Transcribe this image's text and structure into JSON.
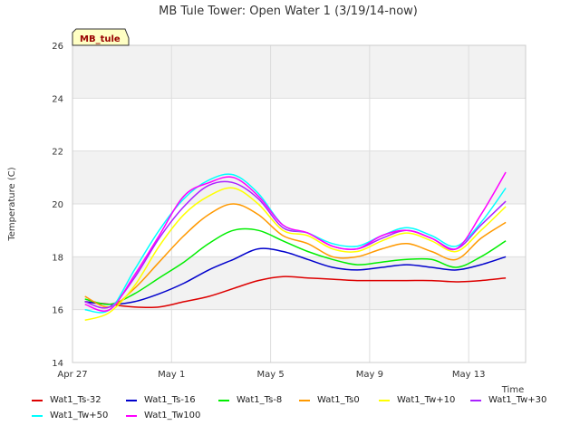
{
  "chart_data": {
    "type": "line",
    "title": "MB Tule Tower: Open Water 1 (3/19/14-now)",
    "xlabel": "Time",
    "ylabel": "Temperature (C)",
    "badge": "MB_tule",
    "xlim": [
      0,
      18.3
    ],
    "ylim": [
      14,
      26
    ],
    "x_ticks": [
      {
        "x": 0,
        "label": "Apr 27"
      },
      {
        "x": 4,
        "label": "May 1"
      },
      {
        "x": 8,
        "label": "May 5"
      },
      {
        "x": 12,
        "label": "May 9"
      },
      {
        "x": 16,
        "label": "May 13"
      }
    ],
    "y_ticks": [
      14,
      16,
      18,
      20,
      22,
      24,
      26
    ],
    "grid": true,
    "legend_position": "bottom",
    "series": [
      {
        "name": "Wat1_Ts-32",
        "color": "#dd0000",
        "x": [
          0.5,
          1.5,
          2.5,
          3.5,
          4.5,
          5.5,
          6.5,
          7.5,
          8.5,
          9.5,
          10.5,
          11.5,
          12.5,
          13.5,
          14.5,
          15.5,
          16.5,
          17.5
        ],
        "y": [
          16.3,
          16.2,
          16.1,
          16.1,
          16.3,
          16.5,
          16.8,
          17.1,
          17.25,
          17.2,
          17.15,
          17.1,
          17.1,
          17.1,
          17.1,
          17.05,
          17.1,
          17.2
        ]
      },
      {
        "name": "Wat1_Ts-16",
        "color": "#0000cc",
        "x": [
          0.5,
          1.5,
          2.5,
          3.5,
          4.5,
          5.5,
          6.5,
          7.5,
          8.5,
          9.5,
          10.5,
          11.5,
          12.5,
          13.5,
          14.5,
          15.5,
          16.5,
          17.5
        ],
        "y": [
          16.3,
          16.2,
          16.3,
          16.6,
          17.0,
          17.5,
          17.9,
          18.3,
          18.2,
          17.9,
          17.6,
          17.5,
          17.6,
          17.7,
          17.6,
          17.5,
          17.7,
          18.0
        ]
      },
      {
        "name": "Wat1_Ts-8",
        "color": "#00ee00",
        "x": [
          0.5,
          1.5,
          2.5,
          3.5,
          4.5,
          5.5,
          6.5,
          7.5,
          8.5,
          9.5,
          10.5,
          11.5,
          12.5,
          13.5,
          14.5,
          15.5,
          16.5,
          17.5
        ],
        "y": [
          16.4,
          16.2,
          16.6,
          17.2,
          17.8,
          18.5,
          19.0,
          19.0,
          18.6,
          18.2,
          17.9,
          17.7,
          17.8,
          17.9,
          17.9,
          17.6,
          18.0,
          18.6
        ]
      },
      {
        "name": "Wat1_Ts0",
        "color": "#ff9900",
        "x": [
          0.5,
          1.5,
          2.5,
          3.5,
          4.5,
          5.5,
          6.5,
          7.5,
          8.5,
          9.5,
          10.5,
          11.5,
          12.5,
          13.5,
          14.5,
          15.5,
          16.5,
          17.5
        ],
        "y": [
          16.5,
          16.1,
          16.8,
          17.8,
          18.8,
          19.6,
          20.0,
          19.6,
          18.8,
          18.5,
          18.0,
          18.0,
          18.3,
          18.5,
          18.2,
          17.9,
          18.7,
          19.3
        ]
      },
      {
        "name": "Wat1_Tw+10",
        "color": "#ffff00",
        "x": [
          0.5,
          1.5,
          2.5,
          3.5,
          4.5,
          5.5,
          6.5,
          7.5,
          8.5,
          9.5,
          10.5,
          11.5,
          12.5,
          13.5,
          14.5,
          15.5,
          16.5,
          17.5
        ],
        "y": [
          15.6,
          15.9,
          16.9,
          18.4,
          19.6,
          20.3,
          20.6,
          20.0,
          19.0,
          18.8,
          18.3,
          18.2,
          18.6,
          18.9,
          18.6,
          18.2,
          19.0,
          19.9
        ]
      },
      {
        "name": "Wat1_Tw+30",
        "color": "#aa22ff",
        "x": [
          0.5,
          1.5,
          2.5,
          3.5,
          4.5,
          5.5,
          6.5,
          7.5,
          8.5,
          9.5,
          10.5,
          11.5,
          12.5,
          13.5,
          14.5,
          15.5,
          16.5,
          17.5
        ],
        "y": [
          16.3,
          16.1,
          17.2,
          18.7,
          19.9,
          20.7,
          20.8,
          20.2,
          19.1,
          18.9,
          18.4,
          18.3,
          18.7,
          19.0,
          18.7,
          18.3,
          19.2,
          20.1
        ]
      },
      {
        "name": "Wat1_Tw+50",
        "color": "#00ffff",
        "x": [
          0.5,
          1.5,
          2.5,
          3.5,
          4.5,
          5.5,
          6.5,
          7.5,
          8.5,
          9.5,
          10.5,
          11.5,
          12.5,
          13.5,
          14.5,
          15.5,
          16.5,
          17.5
        ],
        "y": [
          16.0,
          16.0,
          17.5,
          19.0,
          20.2,
          20.9,
          21.1,
          20.4,
          19.2,
          18.9,
          18.5,
          18.4,
          18.8,
          19.1,
          18.8,
          18.4,
          19.3,
          20.6
        ]
      },
      {
        "name": "Wat1_Tw100",
        "color": "#ff00ff",
        "x": [
          0.5,
          1.5,
          2.5,
          3.5,
          4.5,
          5.5,
          6.5,
          7.5,
          8.5,
          9.5,
          10.5,
          11.5,
          12.5,
          13.5,
          14.5,
          15.5,
          16.5,
          17.5
        ],
        "y": [
          16.2,
          16.0,
          17.3,
          18.8,
          20.3,
          20.8,
          21.0,
          20.3,
          19.2,
          18.9,
          18.4,
          18.3,
          18.8,
          19.0,
          18.7,
          18.3,
          19.6,
          21.2
        ]
      }
    ]
  }
}
